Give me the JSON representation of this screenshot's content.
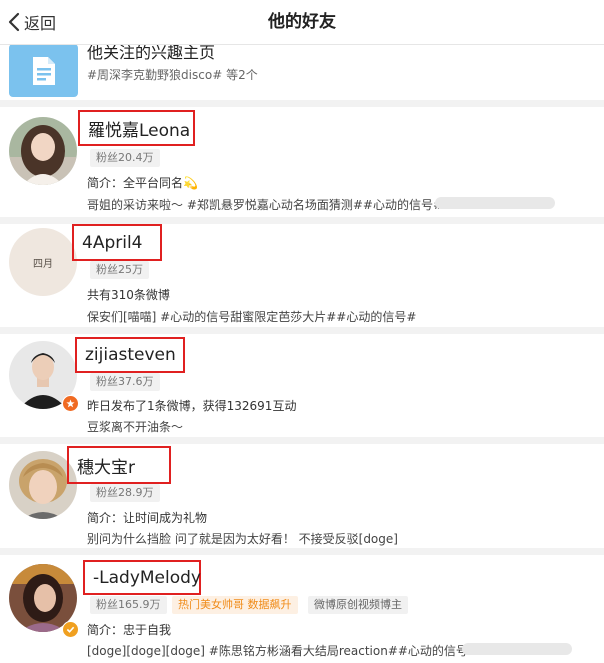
{
  "header": {
    "back_label": "返回",
    "title": "他的好友"
  },
  "interest_page": {
    "title": "他关注的兴趣主页",
    "subtitle": "#周深李克勤野狼disco# 等2个"
  },
  "users": [
    {
      "name": "羅悦嘉Leona",
      "fans": "粉丝20.4万",
      "line1": "简介：全平台同名💫",
      "line2": "哥姐的采访来啦～ #郑凯悬罗悦嘉心动名场面猜测##心动的信号#"
    },
    {
      "name": "4April4",
      "avatar_text": "四月",
      "fans": "粉丝25万",
      "line1": "共有310条微博",
      "line2": "保安们[喵喵] #心动的信号甜蜜限定芭莎大片##心动的信号#"
    },
    {
      "name": "zijiasteven",
      "fans": "粉丝37.6万",
      "line1": "昨日发布了1条微博，获得132691互动",
      "line2": "豆浆离不开油条～"
    },
    {
      "name": "穗大宝r",
      "fans": "粉丝28.9万",
      "line1": "简介：让时间成为礼物",
      "line2": "别问为什么挡脸 问了就是因为太好看！ 不接受反驳[doge]"
    },
    {
      "name": "-LadyMelody",
      "fans": "粉丝165.9万",
      "tag_hot": "热门美女帅哥 数据飙升",
      "tag_original": "微博原创视频博主",
      "line1": "简介：忠于自我",
      "line2": "[doge][doge][doge] #陈思铭方彬涵看大结局reaction##心动的信号#"
    }
  ],
  "colors": {
    "highlight_border": "#e02020",
    "doc_icon_bg": "#7bc2ee",
    "hot_tag": "#f08c1a",
    "separator": "#f2f2f2"
  }
}
